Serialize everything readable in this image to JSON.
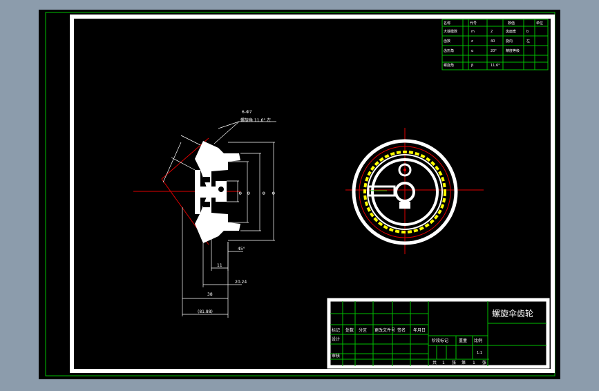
{
  "colors": {
    "desktop": "#8c9cac",
    "sheet": "#000000",
    "frame": "#ffffff",
    "grid": "#00c000",
    "centerline": "#e00000",
    "dimension": "#ffffff",
    "highlight": "#ffff00"
  },
  "callouts": {
    "chamfer_count": "6-Φ7",
    "note": "螺旋角 11.6°  左"
  },
  "dims": {
    "d_ring": "Φ",
    "d_small": "Φ",
    "d1": "Φ",
    "d2": "Φ",
    "w1": "11",
    "w2": "38",
    "total": "(81.88)",
    "offset": "20.24",
    "angle": "45°"
  },
  "param_table": {
    "header": [
      "名称",
      "代号",
      "",
      "数值",
      "单位"
    ],
    "rows": [
      [
        "大端模数",
        "m",
        "2",
        "齿面宽",
        "b"
      ],
      [
        "齿数",
        "z",
        "40",
        "旋向",
        "左"
      ],
      [
        "齿形角",
        "α",
        "20°",
        "精度等级",
        ""
      ],
      [
        "螺旋角",
        "β",
        "11.6°",
        "",
        ""
      ]
    ]
  },
  "title_block": {
    "drawing_title": "螺旋伞齿轮",
    "row_labels": [
      "标记",
      "处数",
      "分区",
      "更改文件号",
      "签名",
      "年月日"
    ],
    "design_label": "设计",
    "review_label": "审核",
    "stage_label": "阶段标记",
    "weight_label": "重量",
    "scale_label": "比例",
    "scale_value": "1:1",
    "sheet_total_label": "共",
    "sheet_total": "1",
    "sheet_unit": "张",
    "sheet_no_label": "第",
    "sheet_no": "1",
    "sheet_unit2": "张"
  }
}
